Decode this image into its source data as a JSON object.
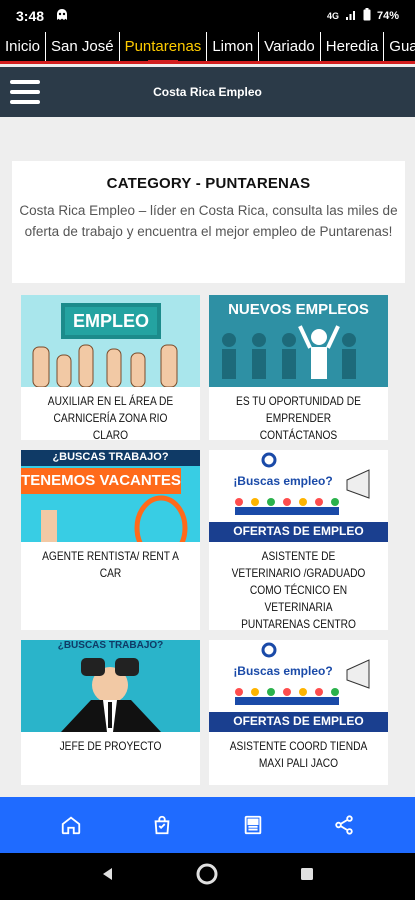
{
  "status": {
    "time": "3:48",
    "network": "4G",
    "battery": "74%"
  },
  "tabs": [
    "Inicio",
    "San José",
    "Puntarenas",
    "Limon",
    "Variado",
    "Heredia",
    "Guan"
  ],
  "active_tab": "Puntarenas",
  "appbar": {
    "title": "Costa Rica Empleo"
  },
  "category": {
    "heading": "CATEGORY - PUNTARENAS",
    "description": "Costa Rica Empleo – líder en Costa Rica, consulta las miles de oferta de trabajo y encuentra el mejor empleo de Puntarenas!"
  },
  "posts": [
    {
      "title": "AUXILIAR EN EL ÁREA DE CARNICERÍA ZONA RIO CLARO",
      "image_text": "EMPLEO"
    },
    {
      "title": "ES TU OPORTUNIDAD DE EMPRENDER CONTÁCTANOS",
      "image_text": "NUEVOS EMPLEOS"
    },
    {
      "title": "AGENTE RENTISTA/ RENT A CAR",
      "image_text_1": "¿BUSCAS TRABAJO?",
      "image_text_2": "TENEMOS VACANTES"
    },
    {
      "title": "ASISTENTE DE VETERINARIO /GRADUADO COMO TÉCNICO EN VETERINARIA PUNTARENAS CENTRO",
      "image_text_1": "¡Buscas empleo?",
      "image_text_2": "OFERTAS DE EMPLEO"
    },
    {
      "title": "JEFE DE PROYECTO",
      "image_text": "¿BUSCAS TRABAJO?"
    },
    {
      "title": "ASISTENTE COORD TIENDA MAXI PALI JACO",
      "image_text_1": "¡Buscas empleo?",
      "image_text_2": "OFERTAS DE EMPLEO"
    }
  ],
  "colors": {
    "appbar": "#2b3a48",
    "bottom_nav": "#1f6bff",
    "active_tab": "#ffcc00",
    "tab_underline": "#d21f1f"
  },
  "bottom_nav": [
    "home-icon",
    "shopping-bag-icon",
    "news-icon",
    "share-icon"
  ]
}
